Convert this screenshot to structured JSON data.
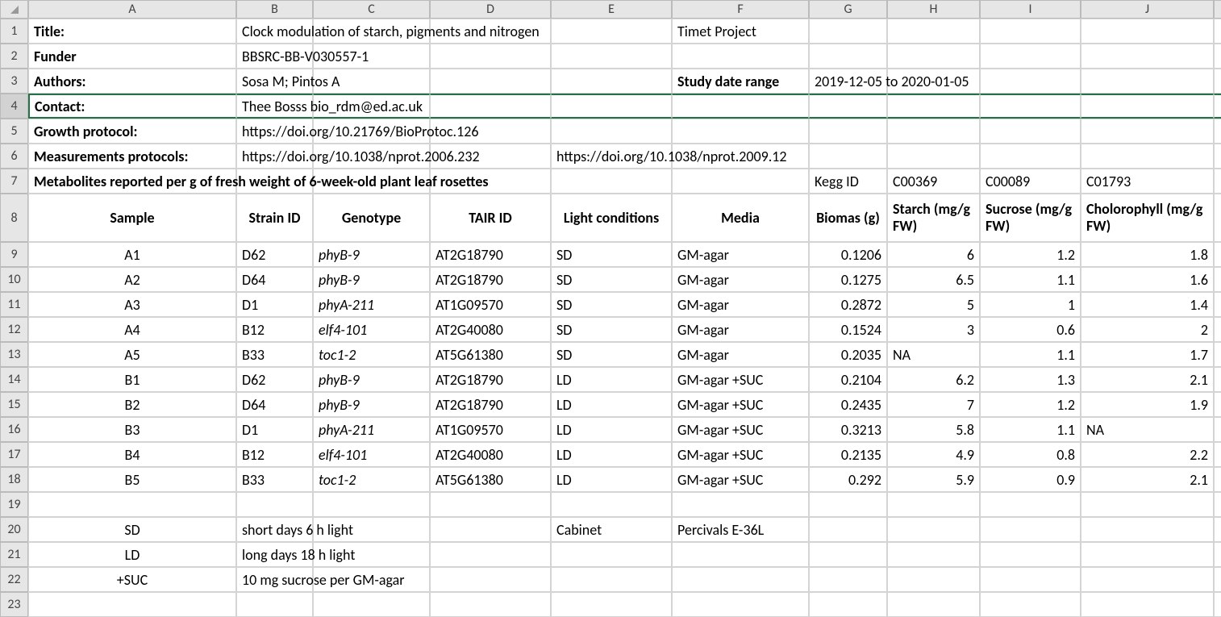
{
  "columns": [
    "A",
    "B",
    "C",
    "D",
    "E",
    "F",
    "G",
    "H",
    "I",
    "J",
    ""
  ],
  "row_labels": [
    "1",
    "2",
    "3",
    "4",
    "5",
    "6",
    "7",
    "8",
    "9",
    "10",
    "11",
    "12",
    "13",
    "14",
    "15",
    "16",
    "17",
    "18",
    "19",
    "20",
    "21",
    "22",
    "23"
  ],
  "selected_row": 4,
  "meta": {
    "r1": {
      "A": "Title:",
      "B": "Clock modulation of starch, pigments and nitrogen",
      "F": "Timet Project"
    },
    "r2": {
      "A": "Funder",
      "B": "BBSRC-BB-V030557-1"
    },
    "r3": {
      "A": "Authors:",
      "B": "Sosa M; Pintos A",
      "F": "Study date range",
      "G": "2019-12-05 to 2020-01-05"
    },
    "r4": {
      "A": "Contact:",
      "B": "Thee Bosss bio_rdm@ed.ac.uk"
    },
    "r5": {
      "A": "Growth protocol:",
      "B": "https://doi.org/10.21769/BioProtoc.126"
    },
    "r6": {
      "A": "Measurements protocols:",
      "B": "https://doi.org/10.1038/nprot.2006.232",
      "E": "https://doi.org/10.1038/nprot.2009.12"
    },
    "r7": {
      "A": "Metabolites reported per g of fresh weight of 6-week-old plant leaf rosettes",
      "G": "Kegg ID",
      "H": "C00369",
      "I": "C00089",
      "J": "C01793"
    }
  },
  "headers": {
    "A": "Sample",
    "B": "Strain ID",
    "C": "Genotype",
    "D": "TAIR ID",
    "E": "Light conditions",
    "F": "Media",
    "G": "Biomas (g)",
    "H": "Starch (mg/g FW)",
    "I": "Sucrose (mg/g FW)",
    "J": "Cholorophyll (mg/g FW)"
  },
  "data": [
    {
      "A": "A1",
      "B": "D62",
      "C": "phyB-9",
      "D": "AT2G18790",
      "E": "SD",
      "F": "GM-agar",
      "G": "0.1206",
      "H": "6",
      "I": "1.2",
      "J": "1.8"
    },
    {
      "A": "A2",
      "B": "D64",
      "C": "phyB-9",
      "D": "AT2G18790",
      "E": "SD",
      "F": "GM-agar",
      "G": "0.1275",
      "H": "6.5",
      "I": "1.1",
      "J": "1.6"
    },
    {
      "A": "A3",
      "B": "D1",
      "C": "phyA-211",
      "D": "AT1G09570",
      "E": "SD",
      "F": "GM-agar",
      "G": "0.2872",
      "H": "5",
      "I": "1",
      "J": "1.4"
    },
    {
      "A": "A4",
      "B": "B12",
      "C": "elf4-101",
      "D": "AT2G40080",
      "E": "SD",
      "F": "GM-agar",
      "G": "0.1524",
      "H": "3",
      "I": "0.6",
      "J": "2"
    },
    {
      "A": "A5",
      "B": "B33",
      "C": "toc1-2",
      "D": "AT5G61380",
      "E": "SD",
      "F": "GM-agar",
      "G": "0.2035",
      "H": "NA",
      "I": "1.1",
      "J": "1.7"
    },
    {
      "A": "B1",
      "B": "D62",
      "C": "phyB-9",
      "D": "AT2G18790",
      "E": "LD",
      "F": "GM-agar +SUC",
      "G": "0.2104",
      "H": "6.2",
      "I": "1.3",
      "J": "2.1"
    },
    {
      "A": "B2",
      "B": "D64",
      "C": "phyB-9",
      "D": "AT2G18790",
      "E": "LD",
      "F": "GM-agar +SUC",
      "G": "0.2435",
      "H": "7",
      "I": "1.2",
      "J": "1.9"
    },
    {
      "A": "B3",
      "B": "D1",
      "C": "phyA-211",
      "D": "AT1G09570",
      "E": "LD",
      "F": "GM-agar +SUC",
      "G": "0.3213",
      "H": "5.8",
      "I": "1.1",
      "J": "NA"
    },
    {
      "A": "B4",
      "B": "B12",
      "C": "elf4-101",
      "D": "AT2G40080",
      "E": "LD",
      "F": "GM-agar +SUC",
      "G": "0.2135",
      "H": "4.9",
      "I": "0.8",
      "J": "2.2"
    },
    {
      "A": "B5",
      "B": "B33",
      "C": "toc1-2",
      "D": "AT5G61380",
      "E": "LD",
      "F": "GM-agar +SUC",
      "G": "0.292",
      "H": "5.9",
      "I": "0.9",
      "J": "2.1"
    }
  ],
  "legend": {
    "r20": {
      "A": "SD",
      "B": "short days 6 h light",
      "E": "Cabinet",
      "F": "Percivals E-36L"
    },
    "r21": {
      "A": "LD",
      "B": "long days 18 h light"
    },
    "r22": {
      "A": "+SUC",
      "B": "10 mg sucrose per GM-agar"
    }
  }
}
